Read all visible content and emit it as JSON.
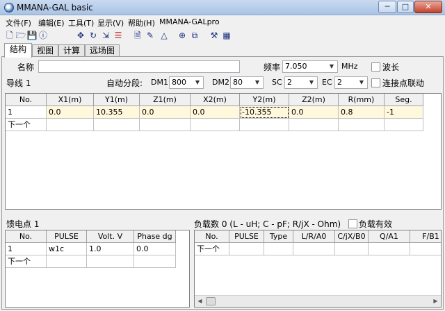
{
  "window": {
    "title": "MMANA-GAL basic",
    "min": "─",
    "max": "□",
    "close": "✕"
  },
  "menu": [
    "文件(F)",
    "编辑(E)",
    "工具(T)",
    "显示(V)",
    "帮助(H)",
    "MMANA-GALpro"
  ],
  "toolbar_icons": [
    "new-icon",
    "open-icon",
    "save-icon",
    "info-icon",
    "move-icon",
    "rotate-icon",
    "resize-icon",
    "split-icon",
    "doc-icon",
    "pen-icon",
    "triangle-icon",
    "target-icon",
    "copy-icon",
    "tools-icon",
    "calculator-icon"
  ],
  "tool_glyphs": [
    "🗋",
    "🗁",
    "💾",
    "ⓘ",
    "✥",
    "↻",
    "⇲",
    "☰",
    "🗎",
    "✎",
    "△",
    "⊕",
    "⧉",
    "⚒",
    "▦"
  ],
  "tabs": [
    "结构",
    "视图",
    "计算",
    "远场图"
  ],
  "form": {
    "name_label": "名称",
    "name_value": "",
    "freq_label": "频率",
    "freq_value": "7.050",
    "freq_unit": "MHz",
    "wavelength_label": "波长",
    "wires_label": "导线 1",
    "autoseg_label": "自动分段:",
    "dm1_label": "DM1",
    "dm1_value": "800",
    "dm2_label": "DM2",
    "dm2_value": "80",
    "sc_label": "SC",
    "sc_value": "2",
    "ec_label": "EC",
    "ec_value": "2",
    "connect_label": "连接点联动"
  },
  "wires": {
    "headers": [
      "No.",
      "X1(m)",
      "Y1(m)",
      "Z1(m)",
      "X2(m)",
      "Y2(m)",
      "Z2(m)",
      "R(mm)",
      "Seg."
    ],
    "rows": [
      [
        "1",
        "0.0",
        "10.355",
        "0.0",
        "0.0",
        "-10.355",
        "0.0",
        "0.8",
        "-1"
      ]
    ],
    "next_label": "下一个"
  },
  "sources": {
    "label": "馈电点 1",
    "headers": [
      "No.",
      "PULSE",
      "Volt. V",
      "Phase dg"
    ],
    "rows": [
      [
        "1",
        "w1c",
        "1.0",
        "0.0"
      ]
    ],
    "next_label": "下一个"
  },
  "loads": {
    "label": "负载数 0 (L - uH; C - pF; R/jX - Ohm)",
    "enable_label": "负载有效",
    "headers": [
      "No.",
      "PULSE",
      "Type",
      "L/R/A0",
      "C/jX/B0",
      "Q/A1",
      "F/B1"
    ],
    "next_label": "下一个"
  }
}
